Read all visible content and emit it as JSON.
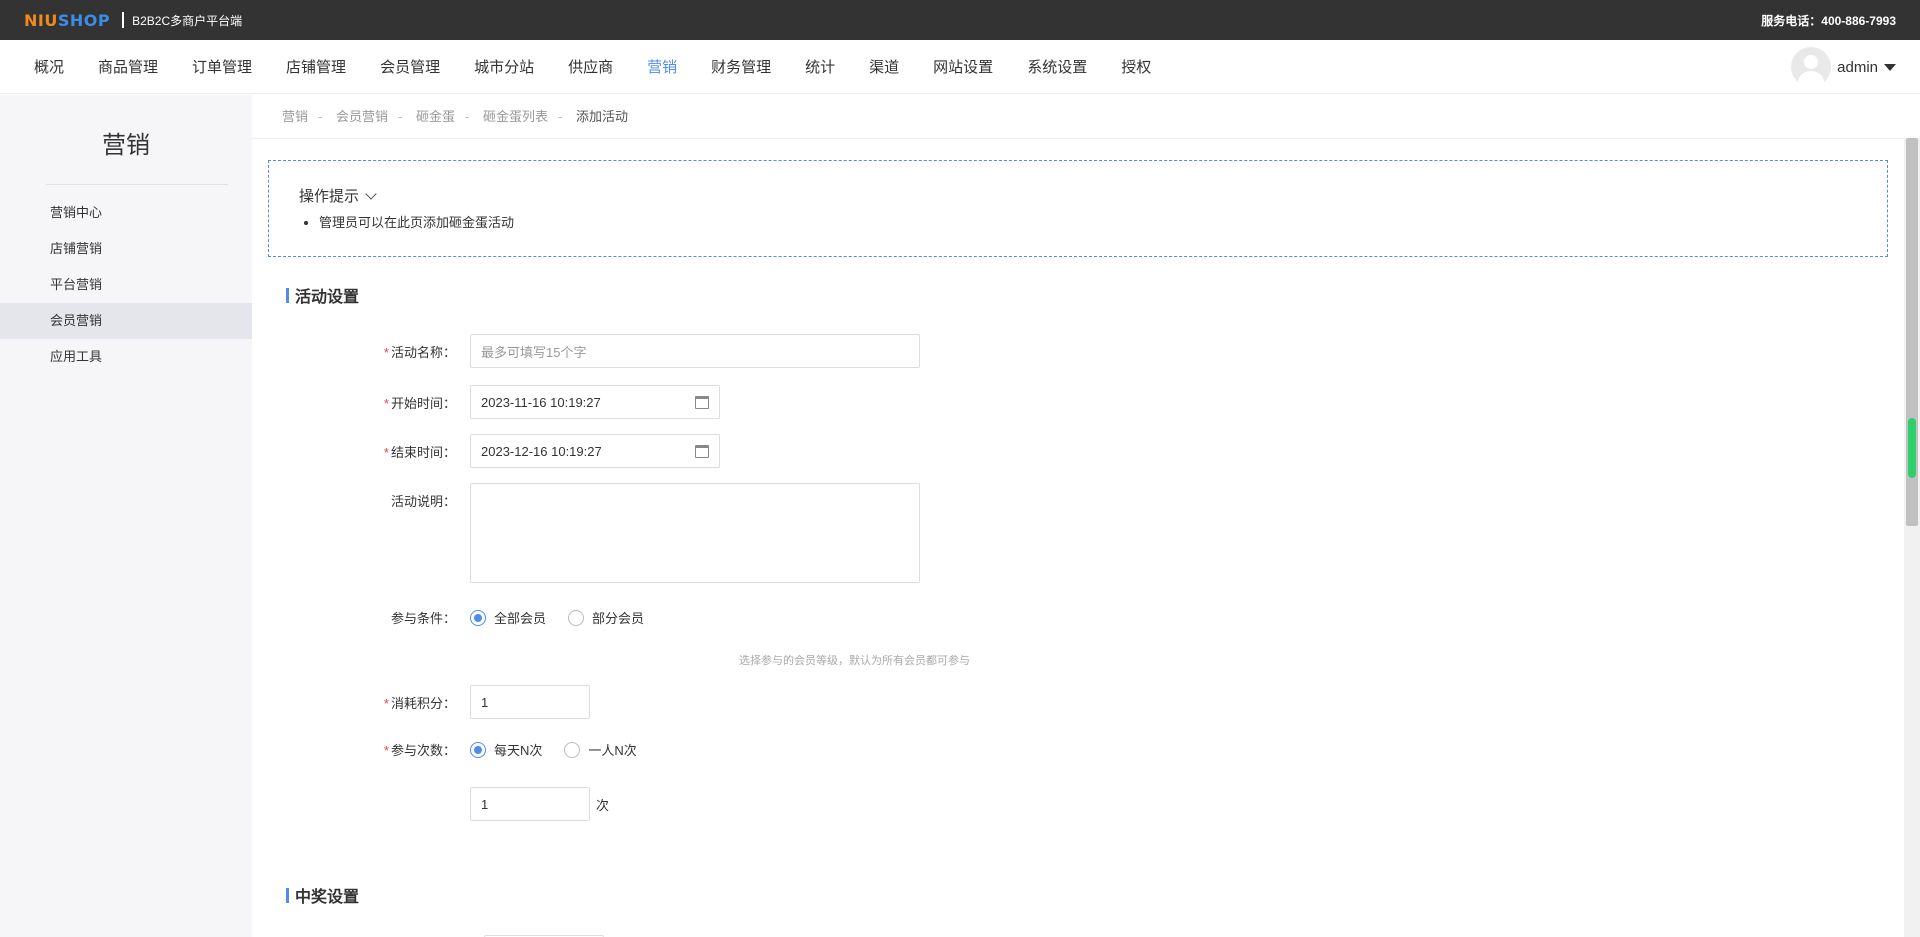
{
  "topbar": {
    "logo_part1": "NIU",
    "logo_part2": "SHOP",
    "platform_name": "B2B2C多商户平台端",
    "service_phone": "服务电话：400-886-7993"
  },
  "nav": {
    "items": [
      "概况",
      "商品管理",
      "订单管理",
      "店铺管理",
      "会员管理",
      "城市分站",
      "供应商",
      "营销",
      "财务管理",
      "统计",
      "渠道",
      "网站设置",
      "系统设置",
      "授权"
    ],
    "active_index": 7,
    "username": "admin"
  },
  "sidebar": {
    "title": "营销",
    "items": [
      "营销中心",
      "店铺营销",
      "平台营销",
      "会员营销",
      "应用工具"
    ],
    "active_index": 3
  },
  "breadcrumb": [
    "营销",
    "会员营销",
    "砸金蛋",
    "砸金蛋列表",
    "添加活动"
  ],
  "tips": {
    "title": "操作提示",
    "items": [
      "管理员可以在此页添加砸金蛋活动"
    ]
  },
  "section_activity": "活动设置",
  "form": {
    "name_label": "活动名称：",
    "name_placeholder": "最多可填写15个字",
    "start_label": "开始时间：",
    "start_value": "2023-11-16 10:19:27",
    "end_label": "结束时间：",
    "end_value": "2023-12-16 10:19:27",
    "desc_label": "活动说明：",
    "condition_label": "参与条件：",
    "condition_options": [
      "全部会员",
      "部分会员"
    ],
    "condition_selected": 0,
    "condition_hint": "选择参与的会员等级，默认为所有会员都可参与",
    "points_label": "消耗积分：",
    "points_value": "1",
    "times_label": "参与次数：",
    "times_options": [
      "每天N次",
      "一人N次"
    ],
    "times_selected": 0,
    "times_value": "1",
    "times_unit": "次"
  },
  "section_prize": "中奖设置"
}
